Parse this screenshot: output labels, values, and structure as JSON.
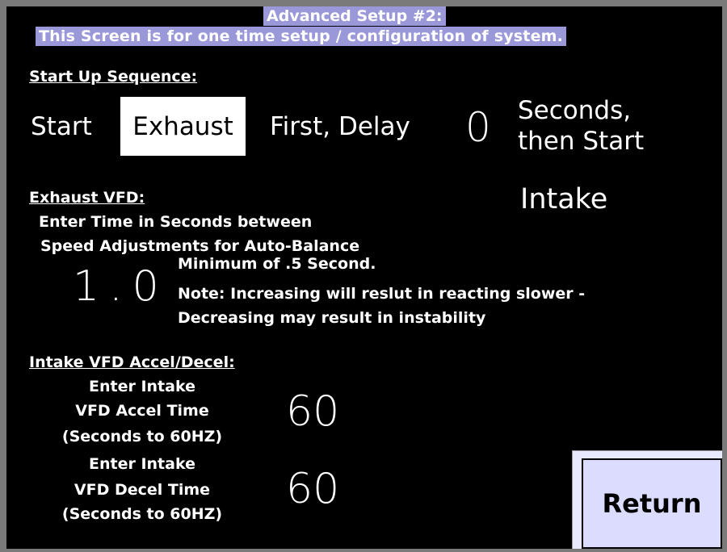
{
  "header": {
    "title": "Advanced Setup #2:",
    "subtitle": "This Screen is for one time setup / configuration  of system."
  },
  "startup": {
    "section_label": "Start Up Sequence:",
    "start_label": "Start",
    "fan_button": "Exhaust",
    "first_delay_label": "First,  Delay",
    "delay_value": "0",
    "seconds_label_line1": "Seconds,",
    "seconds_label_line2": "then Start",
    "then_fan": "Intake"
  },
  "exhaust_vfd": {
    "section_label": "Exhaust VFD:",
    "instruction_line1": "Enter Time in Seconds between",
    "instruction_line2": "Speed Adjustments for Auto-Balance",
    "time_value": "1.0",
    "note_line1": "Minimum of .5 Second.",
    "note_line2": "Note: Increasing will reslut in reacting slower -",
    "note_line3": "Decreasing may result in instability"
  },
  "intake_vfd": {
    "section_label": "Intake VFD Accel/Decel:",
    "accel_label_line1": "Enter Intake",
    "accel_label_line2": "VFD Accel Time",
    "accel_label_line3": "(Seconds to 60HZ)",
    "accel_value": "60",
    "decel_label_line1": "Enter Intake",
    "decel_label_line2": "VFD Decel Time",
    "decel_label_line3": "(Seconds to 60HZ)",
    "decel_value": "60"
  },
  "footer": {
    "return_label": "Return"
  },
  "colors": {
    "background": "#000000",
    "header_highlight": "#9a98d8",
    "button_face": "#dcdcff",
    "text": "#ffffff"
  }
}
